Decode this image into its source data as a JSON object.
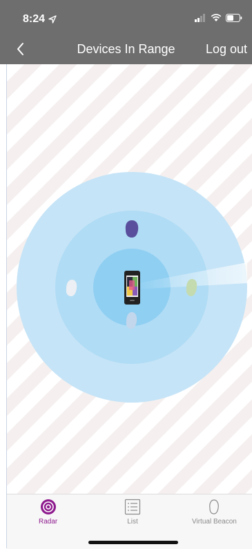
{
  "status_bar": {
    "time": "8:24"
  },
  "nav": {
    "title": "Devices In Range",
    "logout_label": "Log out"
  },
  "radar": {
    "devices": [
      {
        "name": "beacon-purple",
        "color": "#5a4f9c"
      },
      {
        "name": "beacon-white",
        "color": "#eceff3"
      },
      {
        "name": "beacon-green",
        "color": "#c4dbb0"
      },
      {
        "name": "beacon-lightblue",
        "color": "#c3d7ec"
      }
    ]
  },
  "tabs": [
    {
      "label": "Radar",
      "active": true
    },
    {
      "label": "List",
      "active": false
    },
    {
      "label": "Virtual Beacon",
      "active": false
    }
  ],
  "colors": {
    "active": "#8e1b8e",
    "inactive": "#8a8a8a",
    "bar": "#6e6e6e"
  }
}
